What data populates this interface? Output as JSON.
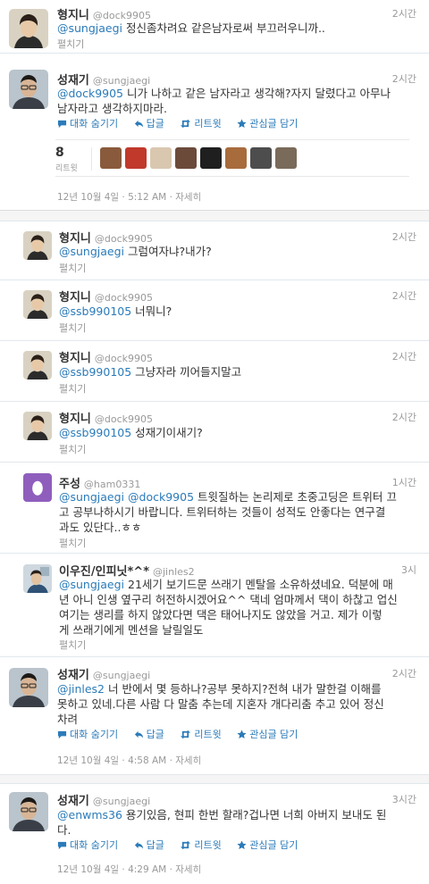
{
  "tweets": [
    {
      "name": "형지니",
      "handle": "@dock9905",
      "time": "2시간",
      "mention": "@sungjaegi",
      "text": " 정신좀차려요 같은남자로써 부끄러우니까..",
      "expand": "펼치기"
    },
    {
      "name": "성재기",
      "handle": "@sungjaegi",
      "time": "2시간",
      "mention": "@dock9905",
      "text_line1": " 니가 나하고 같은 남자라고 생각해?자지 달렸다고 아무나",
      "text_line2": "남자라고 생각하지마라.",
      "actions": {
        "hide": "대화 숨기기",
        "reply": "답글",
        "retweet": "리트윗",
        "favorite": "관심글 담기"
      },
      "rt_count": "8",
      "rt_label": "리트윗",
      "date": "12년 10월 4일 · 5:12 AM · 자세히"
    },
    {
      "name": "형지니",
      "handle": "@dock9905",
      "time": "2시간",
      "mention": "@sungjaegi",
      "text": " 그럼여자냐?내가?",
      "expand": "펼치기"
    },
    {
      "name": "형지니",
      "handle": "@dock9905",
      "time": "2시간",
      "mention": "@ssb990105",
      "text": " 너뭐니?",
      "expand": "펼치기"
    },
    {
      "name": "형지니",
      "handle": "@dock9905",
      "time": "2시간",
      "mention": "@ssb990105",
      "text": " 그냥자라 끼어들지말고",
      "expand": "펼치기"
    },
    {
      "name": "형지니",
      "handle": "@dock9905",
      "time": "2시간",
      "mention": "@ssb990105",
      "text": " 성재기이새기?",
      "expand": "펼치기"
    },
    {
      "name": "주성",
      "handle": "@ham0331",
      "time": "1시간",
      "mention1": "@sungjaegi",
      "mention2": "@dock9905",
      "text_line1": " 트윗질하는 논리제로 초중고딩은 트위터 끄",
      "text_line2": "고 공부나하시기 바랍니다. 트위터하는 것들이 성적도 안좋다는 연구결",
      "text_line3": "과도 있단다..ㅎㅎ",
      "expand": "펼치기"
    },
    {
      "name": "이우진/인피닛*^*",
      "handle": "@jinles2",
      "time": "3시",
      "mention": "@sungjaegi",
      "text_line1": " 21세기 보기드문 쓰래기 멘탈을 소유하셨네요. 덕분에 매",
      "text_line2": "년 아니 인생 옆구리 허전하시겠어요^^ 댁네 엄마께서 댁이 하찮고 업신",
      "text_line3": "여기는 생리를 하지 않았다면 댁은 태어나지도 않았을 거고. 제가 이렇",
      "text_line4": "게 쓰래기에게 멘션을 날릴일도",
      "expand": "펼치기"
    },
    {
      "name": "성재기",
      "handle": "@sungjaegi",
      "time": "2시간",
      "mention": "@jinles2",
      "text_line1": " 너 반에서 몇 등하나?공부 못하지?전혀 내가 말한걸 이해를",
      "text_line2": "못하고 있네.다른 사람 다 말춤 추는데 지혼자 개다리춤 추고 있어 정신",
      "text_line3": "차려",
      "actions": {
        "hide": "대화 숨기기",
        "reply": "답글",
        "retweet": "리트윗",
        "favorite": "관심글 담기"
      },
      "date": "12년 10월 4일 · 4:58 AM · 자세히"
    },
    {
      "name": "성재기",
      "handle": "@sungjaegi",
      "time": "3시간",
      "mention": "@enwms36",
      "text_line1": " 용기있음, 현피 한번 할래?겁나면 너희 아버지 보내도 된",
      "text_line2": "다.",
      "actions": {
        "hide": "대화 숨기기",
        "reply": "답글",
        "retweet": "리트윗",
        "favorite": "관심글 담기"
      },
      "date": "12년 10월 4일 · 4:29 AM · 자세히"
    }
  ],
  "icons": {
    "avatar_hyungjini": "young-man-photo",
    "avatar_sungjaegi": "man-with-glasses-photo",
    "avatar_jusung": "egg-default-avatar",
    "avatar_leewoojin": "person-photo",
    "hide": "speech-bubble-icon",
    "reply": "reply-arrow-icon",
    "retweet": "retweet-arrows-icon",
    "favorite": "star-icon"
  },
  "colors": {
    "link": "#2b7bb9",
    "muted": "#999999",
    "text": "#333333",
    "egg_bg": "#8f5ebd"
  }
}
